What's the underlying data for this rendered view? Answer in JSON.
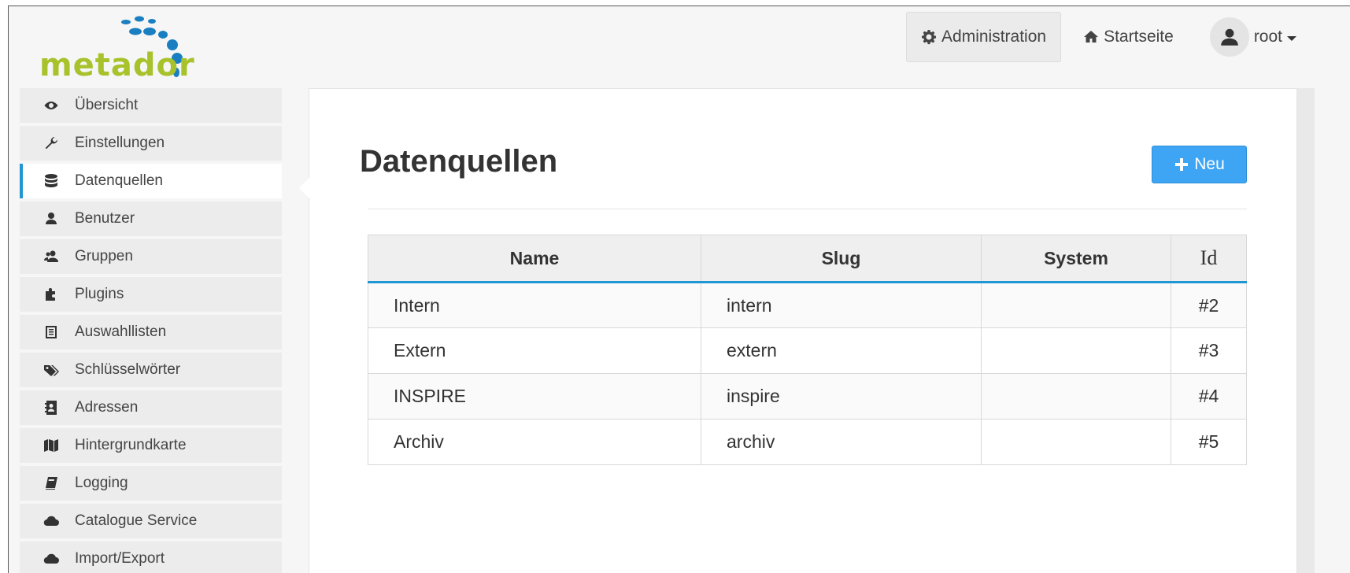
{
  "app": {
    "logo_text": "metador"
  },
  "topnav": {
    "administration": "Administration",
    "startseite": "Startseite",
    "user": "root"
  },
  "sidebar": {
    "items": [
      {
        "label": "Übersicht",
        "icon": "eye-icon"
      },
      {
        "label": "Einstellungen",
        "icon": "wrench-icon"
      },
      {
        "label": "Datenquellen",
        "icon": "database-icon",
        "active": true
      },
      {
        "label": "Benutzer",
        "icon": "user-icon"
      },
      {
        "label": "Gruppen",
        "icon": "users-icon"
      },
      {
        "label": "Plugins",
        "icon": "puzzle-icon"
      },
      {
        "label": "Auswahllisten",
        "icon": "list-icon"
      },
      {
        "label": "Schlüsselwörter",
        "icon": "tags-icon"
      },
      {
        "label": "Adressen",
        "icon": "address-book-icon"
      },
      {
        "label": "Hintergrundkarte",
        "icon": "map-icon"
      },
      {
        "label": "Logging",
        "icon": "book-icon"
      },
      {
        "label": "Catalogue Service",
        "icon": "cloud-icon"
      },
      {
        "label": "Import/Export",
        "icon": "cloud-upload-icon"
      }
    ]
  },
  "main": {
    "title": "Datenquellen",
    "new_button": "Neu",
    "table": {
      "headers": {
        "name": "Name",
        "slug": "Slug",
        "system": "System",
        "id": "Id"
      },
      "rows": [
        {
          "name": "Intern",
          "slug": "intern",
          "system": "",
          "id": "#2"
        },
        {
          "name": "Extern",
          "slug": "extern",
          "system": "",
          "id": "#3"
        },
        {
          "name": "INSPIRE",
          "slug": "inspire",
          "system": "",
          "id": "#4"
        },
        {
          "name": "Archiv",
          "slug": "archiv",
          "system": "",
          "id": "#5"
        }
      ]
    }
  },
  "colors": {
    "accent": "#2196d3",
    "button": "#3ea5f5",
    "logo": "#a8c22c"
  }
}
